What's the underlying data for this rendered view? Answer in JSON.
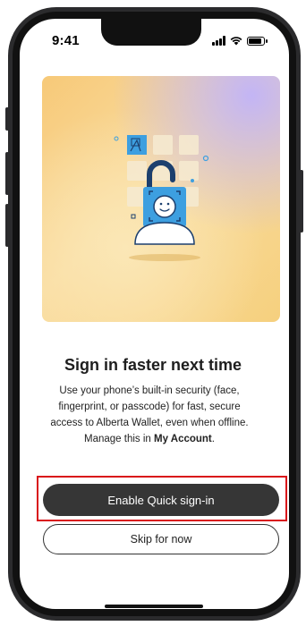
{
  "status_bar": {
    "time": "9:41"
  },
  "hero": {
    "illustration": "unlocked-padlock-with-face-and-keypad"
  },
  "content": {
    "title": "Sign in faster next time",
    "body_prefix": "Use your phone’s built-in security (face, fingerprint, or passcode) for fast, secure access to Alberta Wallet, even when offline. Manage this in ",
    "body_bold": "My Account",
    "body_suffix": "."
  },
  "actions": {
    "primary_label": "Enable Quick sign-in",
    "secondary_label": "Skip for now"
  },
  "colors": {
    "primary_button": "#363636",
    "highlight_border": "#d9121a",
    "lock_blue": "#3d9fe0",
    "hero_yellow": "#f7c978",
    "hero_lavender": "#c3b5f5"
  }
}
